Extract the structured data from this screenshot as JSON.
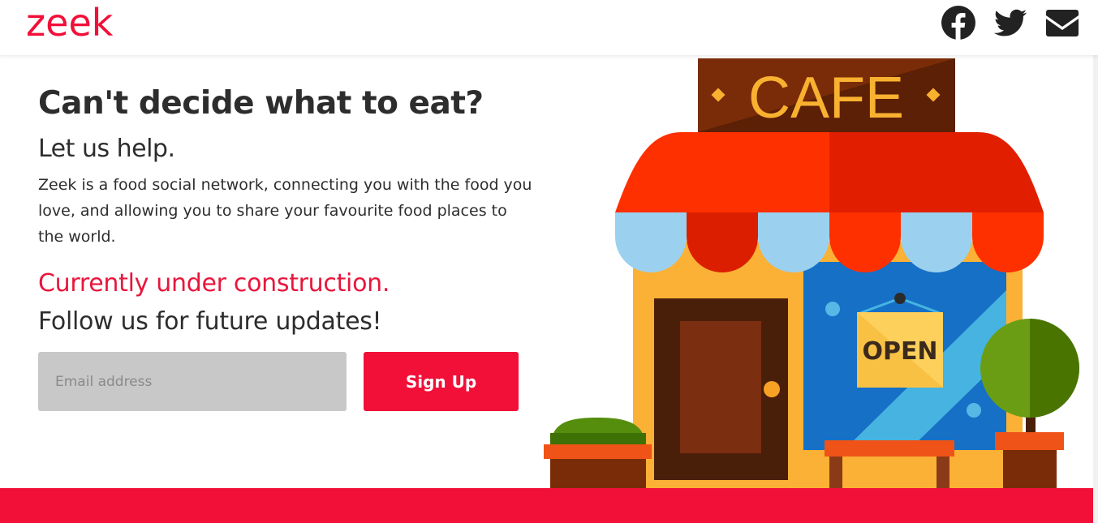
{
  "header": {
    "logo": "zeek",
    "social": [
      {
        "name": "facebook-icon"
      },
      {
        "name": "twitter-icon"
      },
      {
        "name": "envelope-icon"
      }
    ]
  },
  "hero": {
    "headline": "Can't decide what to eat?",
    "subheadline": "Let us help.",
    "description": "Zeek is a food social network, connecting you with the food you love, and allowing you to share your favourite food places to the world.",
    "construction": "Currently under construction.",
    "follow": "Follow us for future updates!"
  },
  "signup": {
    "email_placeholder": "Email address",
    "email_value": "",
    "button_label": "Sign Up"
  },
  "illustration": {
    "sign_text": "CAFE",
    "open_sign": "OPEN"
  },
  "colors": {
    "brand": "#f20f38",
    "input_bg": "#c8c8c8"
  }
}
